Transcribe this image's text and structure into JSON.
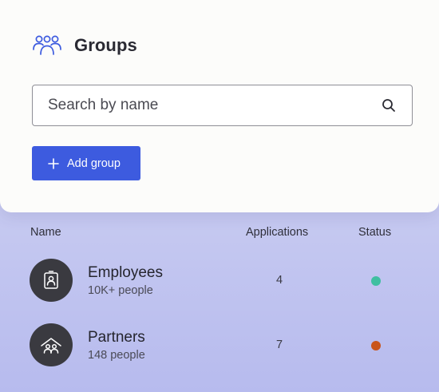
{
  "header": {
    "title": "Groups",
    "icon": "groups-icon"
  },
  "search": {
    "placeholder": "Search by name",
    "value": ""
  },
  "add_button": {
    "label": "Add group",
    "icon": "plus-icon",
    "color": "#3d5bdf"
  },
  "table": {
    "columns": [
      "Name",
      "Applications",
      "Status"
    ],
    "rows": [
      {
        "name": "Employees",
        "subtitle": "10K+ people",
        "applications": "4",
        "icon": "id-badge-icon",
        "status_color": "#3fbfa0"
      },
      {
        "name": "Partners",
        "subtitle": "148 people",
        "applications": "7",
        "icon": "partners-icon",
        "status_color": "#c9551c"
      }
    ]
  }
}
